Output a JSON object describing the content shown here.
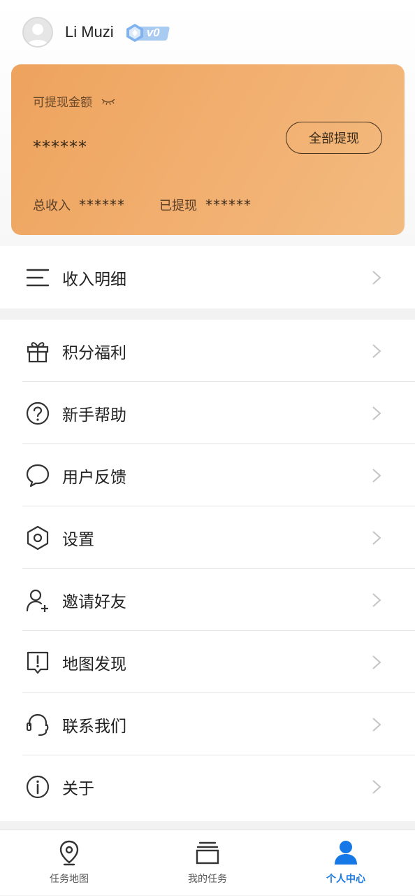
{
  "user": {
    "name": "Li Muzi",
    "level": "v0"
  },
  "wallet": {
    "withdrawable_label": "可提现金额",
    "withdrawable_amount": "******",
    "withdraw_all_button": "全部提现",
    "total_income_label": "总收入",
    "total_income_value": "******",
    "withdrawn_label": "已提现",
    "withdrawn_value": "******"
  },
  "menu": {
    "income_detail": "收入明细",
    "items": [
      {
        "label": "积分福利",
        "icon": "gift-icon"
      },
      {
        "label": "新手帮助",
        "icon": "help-icon"
      },
      {
        "label": "用户反馈",
        "icon": "chat-bubble-icon"
      },
      {
        "label": "设置",
        "icon": "settings-hexagon-icon"
      },
      {
        "label": "邀请好友",
        "icon": "add-user-icon"
      },
      {
        "label": "地图发现",
        "icon": "report-exclamation-icon"
      },
      {
        "label": "联系我们",
        "icon": "headset-icon"
      },
      {
        "label": "关于",
        "icon": "info-icon"
      }
    ]
  },
  "tabbar": {
    "tabs": [
      {
        "label": "任务地图",
        "icon": "map-pin-icon",
        "active": false
      },
      {
        "label": "我的任务",
        "icon": "stack-icon",
        "active": false
      },
      {
        "label": "个人中心",
        "icon": "person-icon",
        "active": true
      }
    ]
  },
  "colors": {
    "accent": "#1677e6",
    "card_gradient_start": "#eea35e",
    "card_gradient_end": "#f3bb80"
  }
}
